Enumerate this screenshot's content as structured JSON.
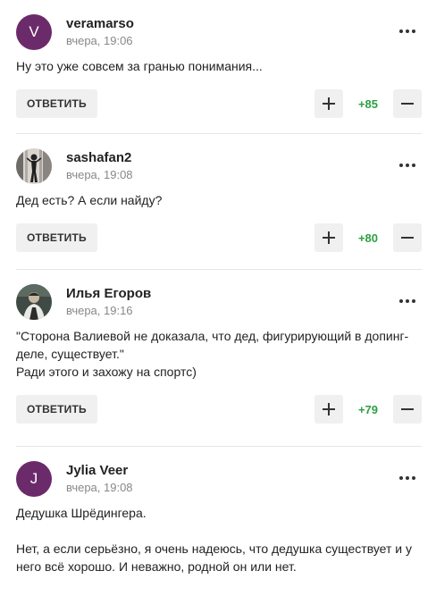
{
  "ui": {
    "reply_label": "ОТВЕТИТЬ"
  },
  "comments": [
    {
      "author": "veramarso",
      "time": "вчера, 19:06",
      "avatar_letter": "V",
      "text": [
        "Ну это уже совсем за гранью понимания..."
      ],
      "score": "+85"
    },
    {
      "author": "sashafan2",
      "time": "вчера, 19:08",
      "text": [
        "Дед есть? А если найду?"
      ],
      "score": "+80"
    },
    {
      "author": "Илья Егоров",
      "time": "вчера, 19:16",
      "text": [
        "\"Сторона Валиевой не доказала, что дед, фигурирующий в допинг-деле, существует.\"",
        "Ради этого и захожу на спортс)"
      ],
      "score": "+79"
    },
    {
      "author": "Jylia Veer",
      "time": "вчера, 19:08",
      "avatar_letter": "J",
      "text": [
        "Дедушка Шрёдингера.",
        "",
        "Нет, а если серьёзно, я очень надеюсь, что дедушка существует и у него всё хорошо. И неважно, родной он или нет."
      ]
    }
  ]
}
